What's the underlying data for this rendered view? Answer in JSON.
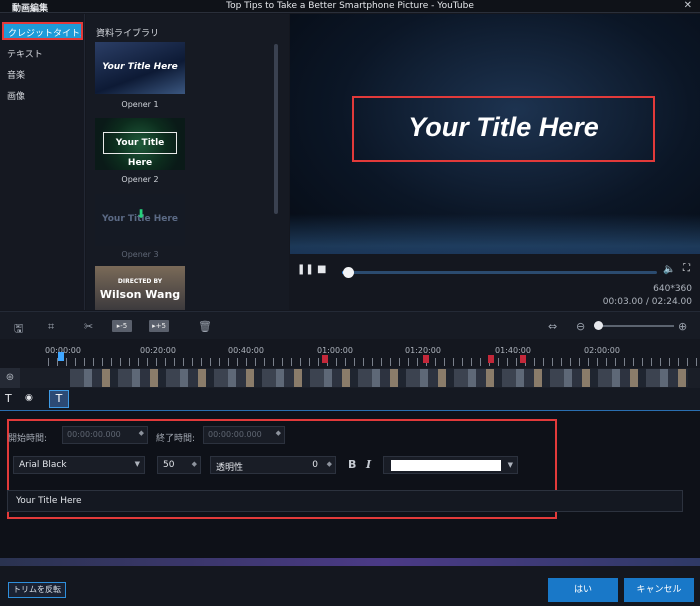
{
  "window": {
    "app_title": "動画編集",
    "title": "Top Tips to Take a Better Smartphone Picture - YouTube",
    "close_glyph": "✕"
  },
  "sidebar": {
    "items": [
      {
        "label": "クレジットタイトル"
      },
      {
        "label": "テキスト"
      },
      {
        "label": "音楽"
      },
      {
        "label": "画像"
      }
    ]
  },
  "library": {
    "title": "資料ライブラリ",
    "items": [
      {
        "thumb_text": "Your Title Here",
        "caption": "Opener 1"
      },
      {
        "thumb_text": "Your Title Here",
        "caption": "Opener 2"
      },
      {
        "thumb_text": "Your Title Here",
        "caption": "Opener 3"
      },
      {
        "thumb_small": "DIRECTED BY",
        "thumb_text": "Wilson Wang"
      }
    ]
  },
  "preview": {
    "title_text": "Your Title Here",
    "resolution": "640*360",
    "timecode": "00:03.00 / 02:24.00",
    "progress": 0.02
  },
  "toolbar": {
    "btn_minus5": "▸-5",
    "btn_plus5": "▸+5",
    "zoom_level": 0.05
  },
  "timeline": {
    "ruler_labels": [
      "00:00:00",
      "00:20:00",
      "00:40:00",
      "01:00:00",
      "01:20:00",
      "01:40:00",
      "02:00:00"
    ]
  },
  "editor": {
    "start_label": "開始時間:",
    "start_value": "00:00:00.000",
    "end_label": "終了時間:",
    "end_value": "00:00:00.000",
    "font": "Arial Black",
    "size": "50",
    "opacity_label": "透明性",
    "opacity_value": "0",
    "bold": "B",
    "italic": "I",
    "text_color": "#ffffff",
    "text_value": "Your Title Here"
  },
  "footer": {
    "trim_button": "トリムを反転",
    "ok_button": "はい",
    "cancel_button": "キャンセル"
  },
  "colors": {
    "accent": "#1d9bd8",
    "highlight": "#e23a3a"
  }
}
